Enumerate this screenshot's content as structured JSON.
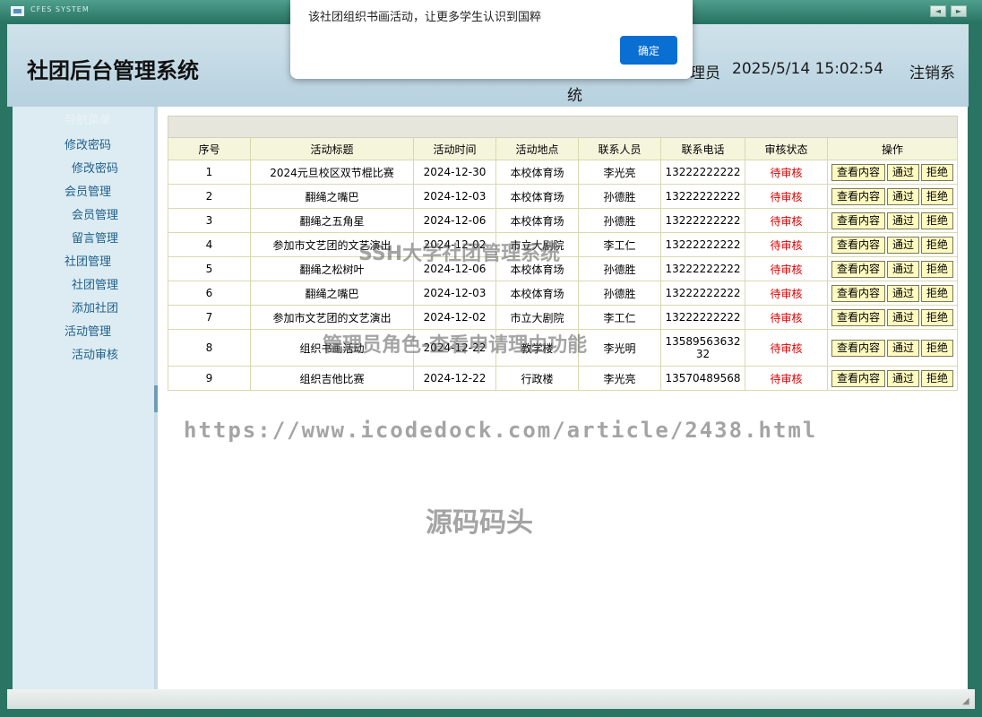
{
  "window": {
    "title": "CFES SYSTEM",
    "nav_prev": "◄",
    "nav_next": "►"
  },
  "header": {
    "title": "社团后台管理系统",
    "role_fragment": "理员",
    "datetime": "2025/5/14 15:02:54",
    "logout": "注销系",
    "logout_wrap": "统"
  },
  "sidebar": {
    "heading": "导航菜单",
    "items": [
      {
        "label": "修改密码",
        "level": 1
      },
      {
        "label": "修改密码",
        "level": 2
      },
      {
        "label": "会员管理",
        "level": 1
      },
      {
        "label": "会员管理",
        "level": 2
      },
      {
        "label": "留言管理",
        "level": 2
      },
      {
        "label": "社团管理",
        "level": 1
      },
      {
        "label": "社团管理",
        "level": 2
      },
      {
        "label": "添加社团",
        "level": 2
      },
      {
        "label": "活动管理",
        "level": 1
      },
      {
        "label": "活动审核",
        "level": 2
      }
    ]
  },
  "table": {
    "headers": [
      "序号",
      "活动标题",
      "活动时间",
      "活动地点",
      "联系人员",
      "联系电话",
      "审核状态",
      "操作"
    ],
    "actions": {
      "view": "查看内容",
      "approve": "通过",
      "reject": "拒绝"
    },
    "rows": [
      [
        "1",
        "2024元旦校区双节棍比赛",
        "2024-12-30",
        "本校体育场",
        "李光亮",
        "13222222222",
        "待审核"
      ],
      [
        "2",
        "翻绳之嘴巴",
        "2024-12-03",
        "本校体育场",
        "孙德胜",
        "13222222222",
        "待审核"
      ],
      [
        "3",
        "翻绳之五角星",
        "2024-12-06",
        "本校体育场",
        "孙德胜",
        "13222222222",
        "待审核"
      ],
      [
        "4",
        "参加市文艺团的文艺演出",
        "2024-12-02",
        "市立大剧院",
        "李工仁",
        "13222222222",
        "待审核"
      ],
      [
        "5",
        "翻绳之松树叶",
        "2024-12-06",
        "本校体育场",
        "孙德胜",
        "13222222222",
        "待审核"
      ],
      [
        "6",
        "翻绳之嘴巴",
        "2024-12-03",
        "本校体育场",
        "孙德胜",
        "13222222222",
        "待审核"
      ],
      [
        "7",
        "参加市文艺团的文艺演出",
        "2024-12-02",
        "市立大剧院",
        "李工仁",
        "13222222222",
        "待审核"
      ],
      [
        "8",
        "组织书画活动",
        "2024-12-22",
        "教学楼",
        "李光明",
        "1358956363232",
        "待审核"
      ],
      [
        "9",
        "组织吉他比赛",
        "2024-12-22",
        "行政楼",
        "李光亮",
        "13570489568",
        "待审核"
      ]
    ]
  },
  "dialog": {
    "message": "该社团组织书画活动，让更多学生认识到国粹",
    "ok_label": "确定"
  },
  "watermarks": [
    "SSH大学社团管理系统",
    "管理员角色-查看申请理由功能",
    "https://www.icodedock.com/article/2438.html",
    "源码码头"
  ]
}
